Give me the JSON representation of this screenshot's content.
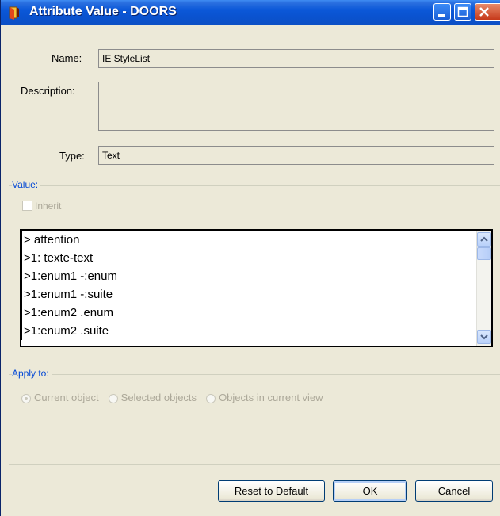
{
  "window": {
    "title": "Attribute Value - DOORS",
    "controls": {
      "minimize": "minimize-button",
      "maximize": "maximize-button",
      "close": "close-button"
    }
  },
  "form": {
    "name_label": "Name:",
    "name_value": "IE StyleList",
    "description_label": "Description:",
    "description_value": "",
    "type_label": "Type:",
    "type_value": "Text"
  },
  "value_group": {
    "label": "Value:",
    "inherit_label": "Inherit",
    "inherit_checked": false,
    "items": [
      "> attention",
      ">1: texte-text",
      ">1:enum1 -:enum",
      ">1:enum1 -:suite",
      ">1:enum2 .enum",
      ">1:enum2 .suite"
    ]
  },
  "apply_group": {
    "label": "Apply to:",
    "options": [
      {
        "label": "Current object",
        "selected": true
      },
      {
        "label": "Selected objects",
        "selected": false
      },
      {
        "label": "Objects in current view",
        "selected": false
      }
    ]
  },
  "buttons": {
    "reset": "Reset to Default",
    "ok": "OK",
    "cancel": "Cancel"
  },
  "colors": {
    "titlebar": "#0b58d8",
    "group_label": "#0046d5",
    "disabled_text": "#aca899",
    "dialog_bg": "#ece9d8"
  }
}
